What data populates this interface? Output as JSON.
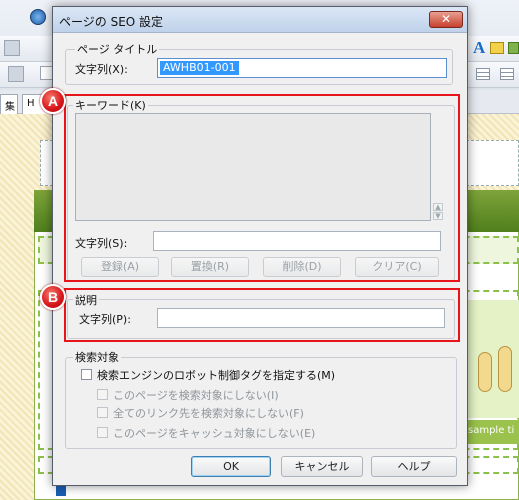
{
  "dialog": {
    "title": "ページの SEO 設定",
    "close_glyph": "✕",
    "page_title_group": {
      "legend": "ページ タイトル",
      "label": "文字列(X):",
      "value": "AWHB01-001"
    },
    "keyword_group": {
      "badge": "A",
      "legend": "キーワード(K)",
      "text_label": "文字列(S):",
      "buttons": {
        "register": "登録(A)",
        "replace": "置換(R)",
        "delete": "削除(D)",
        "clear": "クリア(C)"
      }
    },
    "description_group": {
      "badge": "B",
      "legend": "説明",
      "label": "文字列(P):"
    },
    "search_group": {
      "legend": "検索対象",
      "robot_tag": "検索エンジンのロボット制御タグを指定する(M)",
      "noindex": "このページを検索対象にしない(I)",
      "nofollow": "全てのリンク先を検索対象にしない(F)",
      "nocache": "このページをキャッシュ対象にしない(E)"
    },
    "footer": {
      "ok": "OK",
      "cancel": "キャンセル",
      "help": "ヘルプ"
    }
  },
  "background": {
    "tab_1": "集",
    "tab_2": "H",
    "sample_text": "sample ti"
  }
}
